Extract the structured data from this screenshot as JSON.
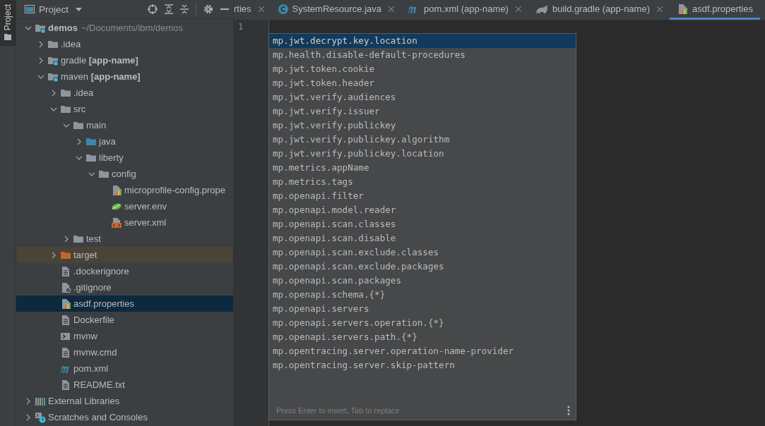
{
  "tool_strip": {
    "tab": "Project"
  },
  "project_panel": {
    "title": "Project"
  },
  "tree": {
    "items": [
      {
        "label": "**demos**",
        "hint": "~/Documents/ibm/demos",
        "kind": "module",
        "expanded": true,
        "selected": false,
        "excluded": false,
        "children": [
          {
            "label": ".idea",
            "kind": "folder",
            "expanded": false,
            "selected": false,
            "excluded": false
          },
          {
            "label": "gradle **[app-name]**",
            "kind": "module",
            "expanded": false,
            "selected": false,
            "excluded": false
          },
          {
            "label": "maven **[app-name]**",
            "kind": "module",
            "expanded": true,
            "selected": false,
            "excluded": false,
            "children": [
              {
                "label": ".idea",
                "kind": "folder",
                "expanded": false,
                "selected": false,
                "excluded": false
              },
              {
                "label": "src",
                "kind": "folder",
                "expanded": true,
                "selected": false,
                "excluded": false,
                "children": [
                  {
                    "label": "main",
                    "kind": "folder",
                    "expanded": true,
                    "selected": false,
                    "excluded": false,
                    "children": [
                      {
                        "label": "java",
                        "kind": "source",
                        "expanded": false,
                        "selected": false,
                        "excluded": false
                      },
                      {
                        "label": "liberty",
                        "kind": "folder",
                        "expanded": true,
                        "selected": false,
                        "excluded": false,
                        "children": [
                          {
                            "label": "config",
                            "kind": "folder",
                            "expanded": true,
                            "selected": false,
                            "excluded": false,
                            "children": [
                              {
                                "label": "microprofile-config.prope",
                                "kind": "properties",
                                "selected": false,
                                "excluded": false
                              },
                              {
                                "label": "server.env",
                                "kind": "env",
                                "selected": false,
                                "excluded": false
                              },
                              {
                                "label": "server.xml",
                                "kind": "xml",
                                "selected": false,
                                "excluded": false
                              }
                            ]
                          }
                        ]
                      }
                    ]
                  },
                  {
                    "label": "test",
                    "kind": "folder",
                    "expanded": false,
                    "selected": false,
                    "excluded": false
                  }
                ]
              },
              {
                "label": "target",
                "kind": "excluded",
                "expanded": false,
                "selected": false,
                "excluded": true
              },
              {
                "label": ".dockerignore",
                "kind": "file",
                "selected": false,
                "excluded": false
              },
              {
                "label": ".gitignore",
                "kind": "ignore",
                "selected": false,
                "excluded": false
              },
              {
                "label": "asdf.properties",
                "kind": "properties",
                "selected": true,
                "excluded": false
              },
              {
                "label": "Dockerfile",
                "kind": "file",
                "selected": false,
                "excluded": false
              },
              {
                "label": "mvnw",
                "kind": "script",
                "selected": false,
                "excluded": false
              },
              {
                "label": "mvnw.cmd",
                "kind": "file",
                "selected": false,
                "excluded": false
              },
              {
                "label": "pom.xml",
                "kind": "maven",
                "selected": false,
                "excluded": false
              },
              {
                "label": "README.txt",
                "kind": "file",
                "selected": false,
                "excluded": false
              }
            ]
          }
        ]
      },
      {
        "label": "External Libraries",
        "kind": "libraries",
        "expanded": false,
        "selected": false,
        "excluded": false
      },
      {
        "label": "Scratches and Consoles",
        "kind": "scratches",
        "expanded": false,
        "selected": false,
        "excluded": false
      }
    ]
  },
  "tabs": [
    {
      "label": "rties",
      "kind": "none",
      "selected": false
    },
    {
      "label": "SystemResource.java",
      "kind": "class",
      "selected": false
    },
    {
      "label": "pom.xml (app-name)",
      "kind": "maven",
      "selected": false
    },
    {
      "label": "build.gradle (app-name)",
      "kind": "gradle",
      "selected": false
    },
    {
      "label": "asdf.properties",
      "kind": "properties",
      "selected": true
    }
  ],
  "editor": {
    "line_numbers": [
      "1"
    ]
  },
  "completion": {
    "items": [
      {
        "text": "mp.jwt.decrypt.key.location",
        "selected": true
      },
      {
        "text": "mp.health.disable-default-procedures",
        "selected": false
      },
      {
        "text": "mp.jwt.token.cookie",
        "selected": false
      },
      {
        "text": "mp.jwt.token.header",
        "selected": false
      },
      {
        "text": "mp.jwt.verify.audiences",
        "selected": false
      },
      {
        "text": "mp.jwt.verify.issuer",
        "selected": false
      },
      {
        "text": "mp.jwt.verify.publickey",
        "selected": false
      },
      {
        "text": "mp.jwt.verify.publickey.algorithm",
        "selected": false
      },
      {
        "text": "mp.jwt.verify.publickey.location",
        "selected": false
      },
      {
        "text": "mp.metrics.appName",
        "selected": false
      },
      {
        "text": "mp.metrics.tags",
        "selected": false
      },
      {
        "text": "mp.openapi.filter",
        "selected": false
      },
      {
        "text": "mp.openapi.model.reader",
        "selected": false
      },
      {
        "text": "mp.openapi.scan.classes",
        "selected": false
      },
      {
        "text": "mp.openapi.scan.disable",
        "selected": false
      },
      {
        "text": "mp.openapi.scan.exclude.classes",
        "selected": false
      },
      {
        "text": "mp.openapi.scan.exclude.packages",
        "selected": false
      },
      {
        "text": "mp.openapi.scan.packages",
        "selected": false
      },
      {
        "text": "mp.openapi.schema.{*}",
        "selected": false
      },
      {
        "text": "mp.openapi.servers",
        "selected": false
      },
      {
        "text": "mp.openapi.servers.operation.{*}",
        "selected": false
      },
      {
        "text": "mp.openapi.servers.path.{*}",
        "selected": false
      },
      {
        "text": "mp.opentracing.server.operation-name-provider",
        "selected": false
      },
      {
        "text": "mp.opentracing.server.skip-pattern",
        "selected": false
      }
    ],
    "hint": "Press Enter to insert, Tab to replace"
  }
}
